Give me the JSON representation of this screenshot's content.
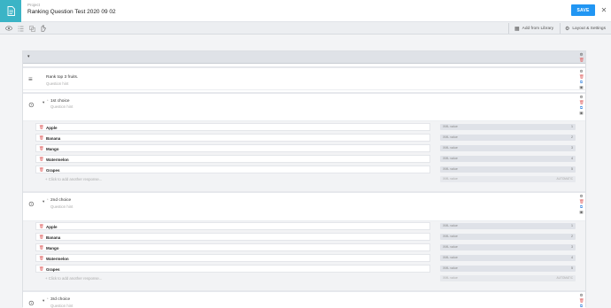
{
  "header": {
    "project_label": "Project",
    "project_name": "Ranking Question Test 2020 09 02",
    "save_label": "SAVE",
    "close_symbol": "✕"
  },
  "toolbar": {
    "add_from_library": "Add from Library",
    "layout_settings": "Layout & Settings",
    "icons": [
      "eye-icon",
      "list-icon",
      "copy-icon",
      "hand-icon"
    ]
  },
  "intro": {
    "title": "Rank top 3 fruits.",
    "subtitle": "Question hint"
  },
  "choices": [
    {
      "title": "1st choice",
      "subtitle": "Question hint",
      "mark": "*",
      "responses": [
        {
          "label": "Apple",
          "xml_label": "XML value",
          "xml_value": "1"
        },
        {
          "label": "Banana",
          "xml_label": "XML value",
          "xml_value": "2"
        },
        {
          "label": "Mango",
          "xml_label": "XML value",
          "xml_value": "3"
        },
        {
          "label": "Watermelon",
          "xml_label": "XML value",
          "xml_value": "4"
        },
        {
          "label": "Grapes",
          "xml_label": "XML value",
          "xml_value": "5"
        }
      ],
      "add_label": "+ Click to add another response...",
      "auto_label": "XML value",
      "auto_value": "AUTOMATIC"
    },
    {
      "title": "2nd choice",
      "subtitle": "Question hint",
      "mark": "*",
      "responses": [
        {
          "label": "Apple",
          "xml_label": "XML value",
          "xml_value": "1"
        },
        {
          "label": "Banana",
          "xml_label": "XML value",
          "xml_value": "2"
        },
        {
          "label": "Mango",
          "xml_label": "XML value",
          "xml_value": "3"
        },
        {
          "label": "Watermelon",
          "xml_label": "XML value",
          "xml_value": "4"
        },
        {
          "label": "Grapes",
          "xml_label": "XML value",
          "xml_value": "5"
        }
      ],
      "add_label": "+ Click to add another response...",
      "auto_label": "XML value",
      "auto_value": "AUTOMATIC"
    },
    {
      "title": "3rd choice",
      "subtitle": "Question hint",
      "mark": "*"
    }
  ],
  "colors": {
    "accent": "#2196f3",
    "brand": "#3bb4c6",
    "delete": "#e06666"
  }
}
